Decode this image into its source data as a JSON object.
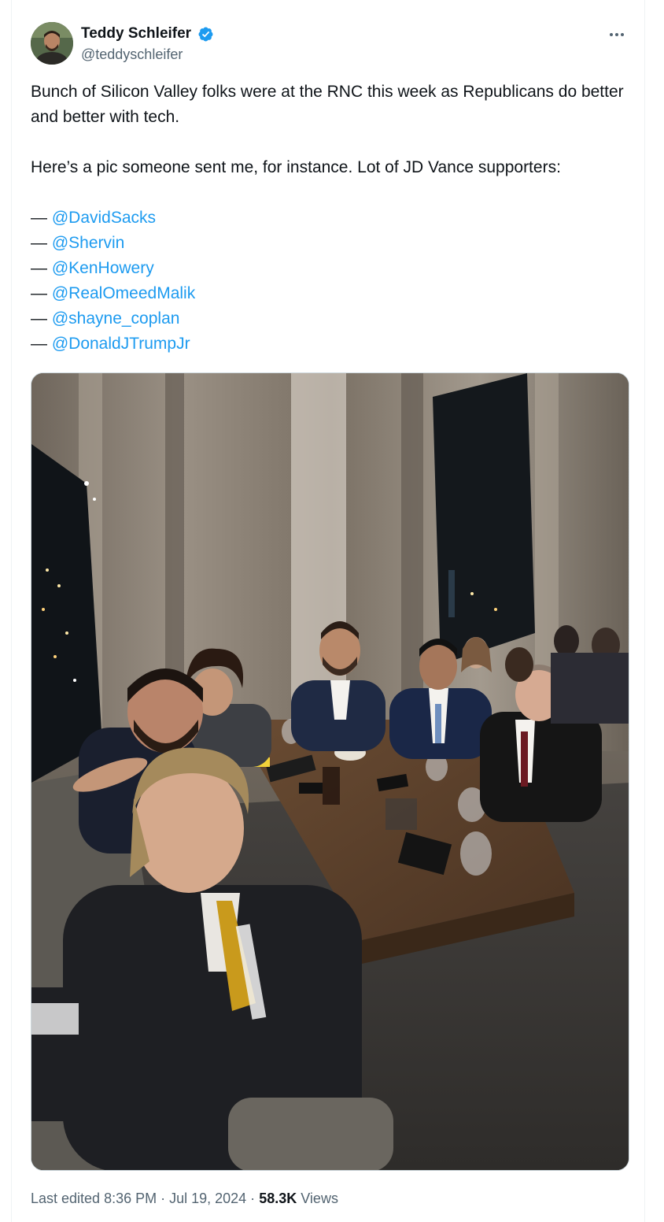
{
  "tweet": {
    "author": {
      "display_name": "Teddy Schleifer",
      "handle": "@teddyschleifer",
      "verified": true,
      "verified_color": "#1d9bf0"
    },
    "text_lines": [
      "Bunch of Silicon Valley folks were at the RNC this week as Republicans do better and better with tech.",
      "Here’s a pic someone sent me, for instance. Lot of JD Vance supporters:"
    ],
    "mention_prefix": "—",
    "mentions": [
      "@DavidSacks",
      "@Shervin",
      "@KenHowery",
      "@RealOmeedMalik",
      "@shayne_coplan",
      "@DonaldJTrumpJr"
    ],
    "meta": {
      "edited_label": "Last edited 8:36 PM · Jul 19, 2024 ·",
      "views_count": "58.3K",
      "views_label": "Views"
    }
  },
  "colors": {
    "link": "#1d9bf0",
    "text": "#0f1419",
    "secondary": "#536471"
  },
  "icons": {
    "verified": "verified-badge-icon",
    "more": "more-icon"
  }
}
